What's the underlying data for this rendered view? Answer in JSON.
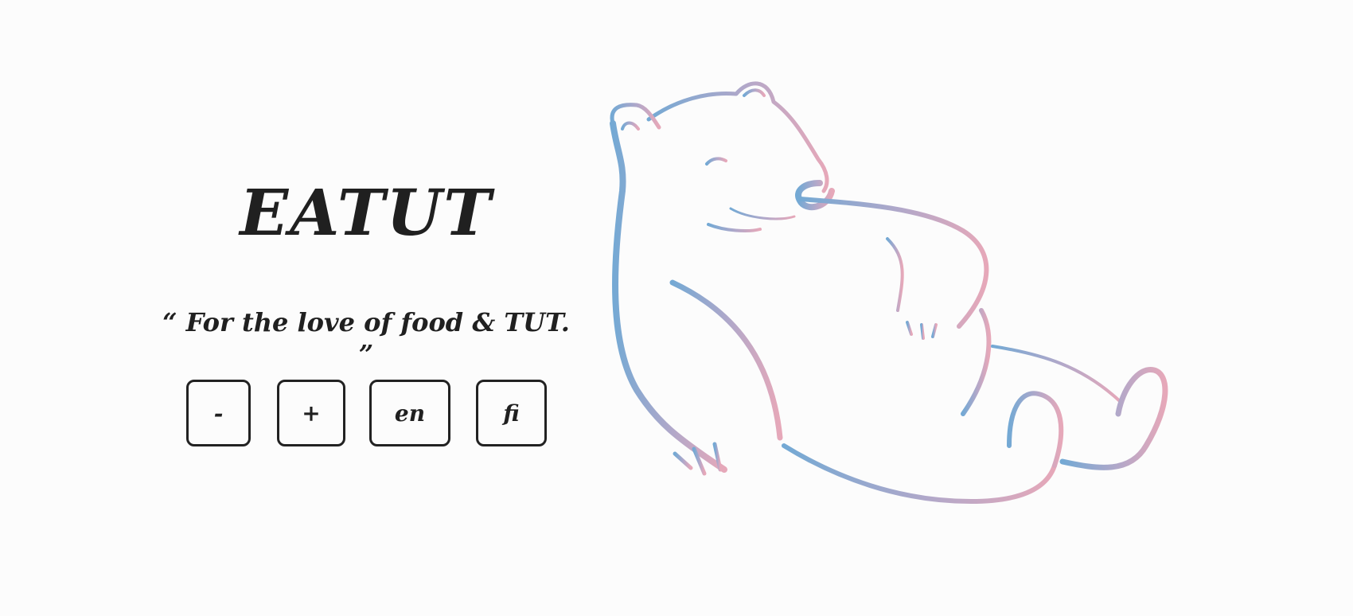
{
  "title": "EATUT",
  "tagline": "“ For the love of food & TUT. ”",
  "controls": {
    "decrease_label": "-",
    "increase_label": "+",
    "lang_en_label": "en",
    "lang_fi_label": "fi"
  },
  "colors": {
    "gradient_start": "#74a9d4",
    "gradient_end": "#e6a8b9",
    "text": "#202020",
    "background": "#fcfcfc"
  },
  "illustration": "polar-bear-line-art"
}
